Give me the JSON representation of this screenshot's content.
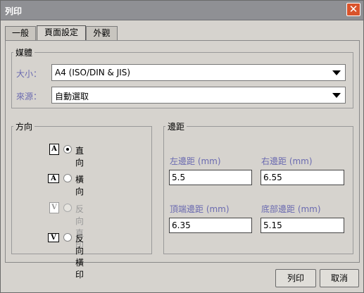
{
  "window": {
    "title": "列印",
    "close_glyph": "✕"
  },
  "tabs": [
    {
      "label": "一般",
      "selected": false
    },
    {
      "label": "頁面設定",
      "selected": true
    },
    {
      "label": "外觀",
      "selected": false
    }
  ],
  "media": {
    "legend": "媒體",
    "size_label": "大小：",
    "size_value": "A4 (ISO/DIN & JIS)",
    "source_label": "來源：",
    "source_value": "自動選取"
  },
  "orientation": {
    "legend": "方向",
    "options": [
      {
        "label": "直向",
        "icon_char": "A",
        "selected": true,
        "enabled": true
      },
      {
        "label": "橫向",
        "icon_char": "A",
        "selected": false,
        "enabled": true
      },
      {
        "label": "反向直印",
        "icon_char": "V",
        "selected": false,
        "enabled": false
      },
      {
        "label": "反向橫印",
        "icon_char": "V",
        "selected": false,
        "enabled": true
      }
    ]
  },
  "margins": {
    "legend": "邊距",
    "left_label": "左邊距 (mm)",
    "left_value": "5.5",
    "right_label": "右邊距 (mm)",
    "right_value": "6.55",
    "top_label": "頂端邊距 (mm)",
    "top_value": "6.35",
    "bottom_label": "底部邊距 (mm)",
    "bottom_value": "5.15"
  },
  "buttons": {
    "print": "列印",
    "cancel": "取消"
  },
  "colors": {
    "titlebar": "#8f9094",
    "close": "#d9532b",
    "field_label": "#6a6ab0"
  }
}
